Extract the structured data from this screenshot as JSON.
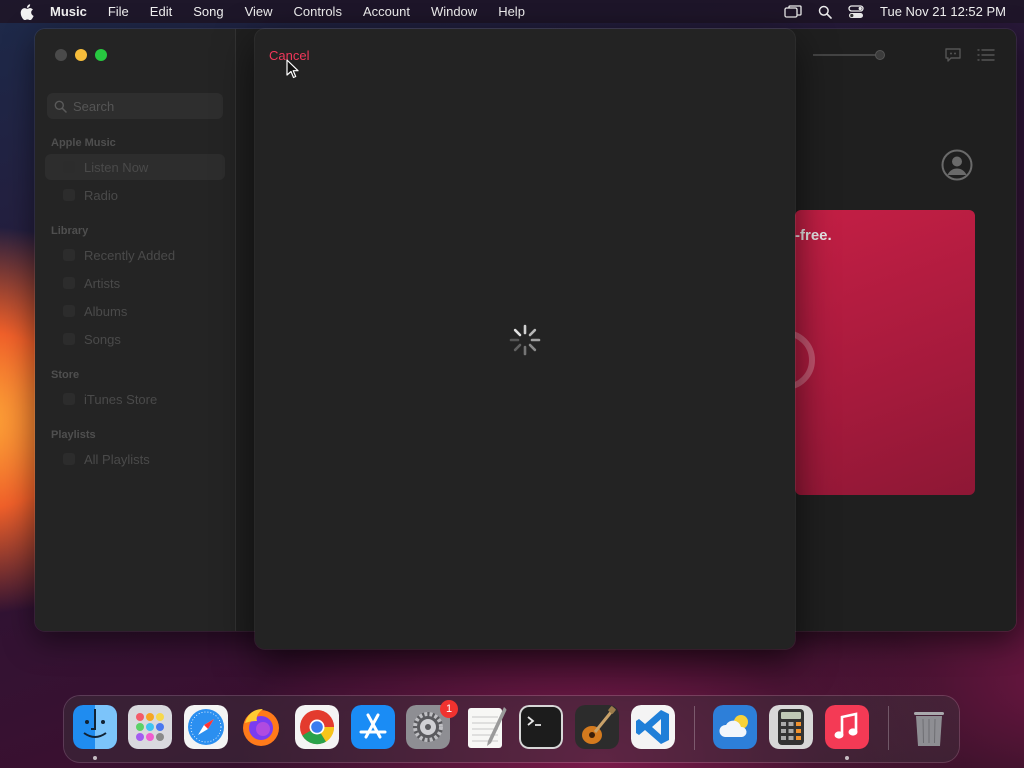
{
  "menubar": {
    "app_name": "Music",
    "items": [
      "File",
      "Edit",
      "Song",
      "View",
      "Controls",
      "Account",
      "Window",
      "Help"
    ],
    "clock": "Tue Nov 21  12:52 PM"
  },
  "sidebar": {
    "search_placeholder": "Search",
    "sections": {
      "apple_music": "Apple Music",
      "library": "Library",
      "store": "Store",
      "playlists": "Playlists"
    },
    "items": {
      "listen_now": "Listen Now",
      "radio": "Radio",
      "recently_added": "Recently Added",
      "artists": "Artists",
      "albums": "Albums",
      "songs": "Songs",
      "itunes_store": "iTunes Store",
      "all_playlists": "All Playlists"
    },
    "selected": "Listen Now"
  },
  "main": {
    "promo_text": "-free."
  },
  "sheet": {
    "cancel_label": "Cancel",
    "loading": true
  },
  "dock": {
    "apps": [
      "finder",
      "launchpad",
      "safari",
      "firefox",
      "chrome",
      "app-store",
      "system-settings",
      "textedit",
      "terminal",
      "garageband",
      "vscode",
      "weather",
      "calculator",
      "music",
      "trash"
    ],
    "system_settings_badge": "1"
  },
  "colors": {
    "accent_red": "#f0375a",
    "promo_red": "#c41f45",
    "traffic_yellow": "#f6bd3b",
    "traffic_green": "#27c840"
  }
}
